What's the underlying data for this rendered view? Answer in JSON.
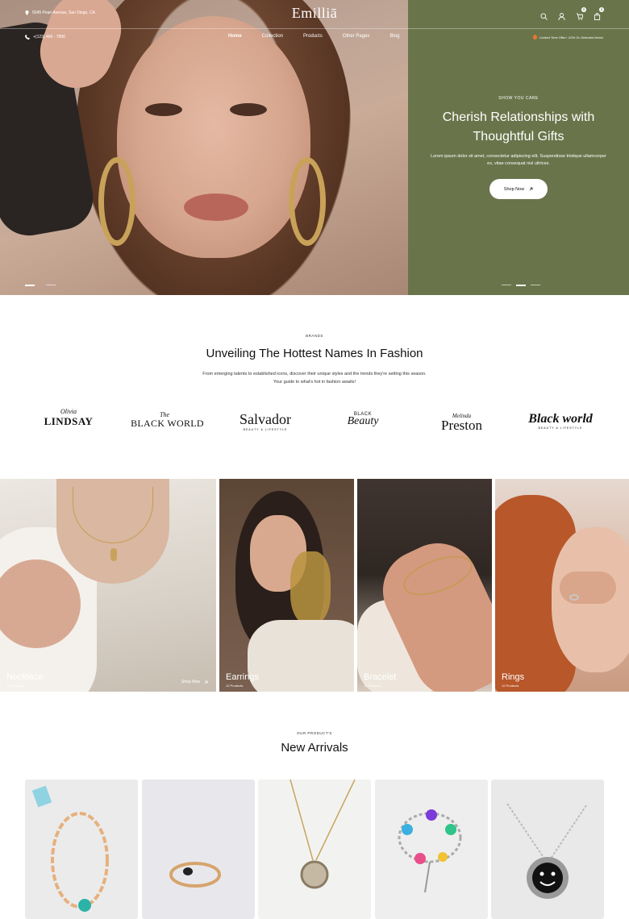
{
  "header": {
    "address": "5045 Pearl Avenue, San Diego, CA",
    "phone": "+(123) 456 - 7890",
    "logo": "Emilliā",
    "nav": [
      "Home",
      "Collection",
      "Products",
      "Other Pages",
      "Blog"
    ],
    "offer": "Limited Time Offer! -20% On Selected Items!",
    "wishlist_count": "0",
    "cart_count": "0",
    "icons": [
      "search-icon",
      "user-icon",
      "wishlist-icon",
      "cart-icon"
    ]
  },
  "hero": {
    "eyebrow": "SHOW YOU CARE",
    "title_line1": "Cherish Relationships with",
    "title_line2": "Thoughtful Gifts",
    "description": "Lorem ipsum dolor sit amet, consectetur adipiscing elit. Suspendisse tristique ullamcorper ex, vitae consequat nisl ultrices.",
    "button": "Shop Now",
    "panel_color": "#6a744a"
  },
  "brands": {
    "eyebrow": "BRANDS",
    "title": "Unveiling The Hottest Names In Fashion",
    "desc_line1": "From emerging talents to established icons, discover their unique styles and the trends they're setting this season.",
    "desc_line2": "Your guide to what's hot in fashion awaits!",
    "logos": [
      {
        "small": "Olivia",
        "main": "LINDSAY"
      },
      {
        "small": "The",
        "main": "BLACK WORLD"
      },
      {
        "main": "Salvador",
        "small": "BEAUTY & LIFESTYLE"
      },
      {
        "small": "BLACK",
        "main": "Beauty"
      },
      {
        "small": "Melinda",
        "main": "Preston"
      },
      {
        "main": "Black world",
        "small": "BEAUTY & LIFESTYLE"
      }
    ]
  },
  "categories": [
    {
      "name": "Necklace",
      "count": "12 Products",
      "cta": "Shop Now"
    },
    {
      "name": "Earrings",
      "count": "12 Products"
    },
    {
      "name": "Bracelet",
      "count": "12 Products"
    },
    {
      "name": "Rings",
      "count": "12 Products"
    }
  ],
  "new_arrivals": {
    "eyebrow": "OUR PRODUCT'S",
    "title": "New Arrivals"
  }
}
